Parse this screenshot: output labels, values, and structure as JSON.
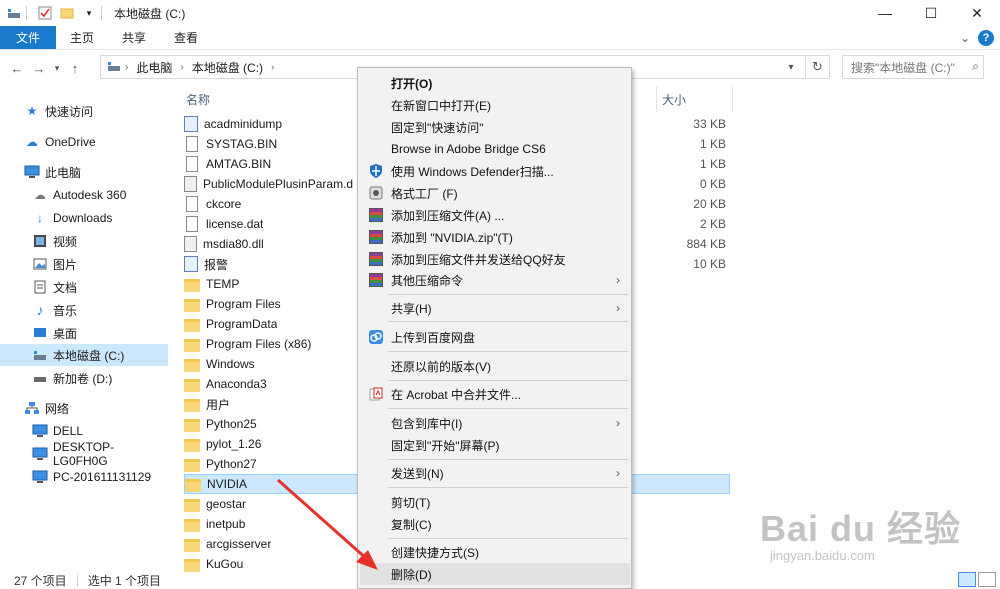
{
  "window": {
    "title": "本地磁盘 (C:)",
    "controls": {
      "minimize": "—",
      "maximize": "☐",
      "close": "✕"
    }
  },
  "ribbon": {
    "tabs": [
      "文件",
      "主页",
      "共享",
      "查看"
    ],
    "expand": "⌄",
    "help": "?"
  },
  "address": {
    "crumbs": [
      "此电脑",
      "本地磁盘 (C:)"
    ],
    "search_placeholder": "搜索\"本地磁盘 (C:)\""
  },
  "nav": {
    "items": [
      {
        "label": "快速访问",
        "icon": "star-icon"
      },
      {
        "label": "OneDrive",
        "icon": "cloud-icon"
      },
      {
        "label": "此电脑",
        "icon": "computer-icon"
      },
      {
        "label": "Autodesk 360",
        "icon": "cloud-drive-icon"
      },
      {
        "label": "Downloads",
        "icon": "download-icon"
      },
      {
        "label": "视频",
        "icon": "video-icon"
      },
      {
        "label": "图片",
        "icon": "picture-icon"
      },
      {
        "label": "文档",
        "icon": "document-icon"
      },
      {
        "label": "音乐",
        "icon": "music-icon"
      },
      {
        "label": "桌面",
        "icon": "desktop-icon"
      },
      {
        "label": "本地磁盘 (C:)",
        "icon": "drive-icon"
      },
      {
        "label": "新加卷 (D:)",
        "icon": "drive-icon"
      },
      {
        "label": "网络",
        "icon": "network-icon"
      },
      {
        "label": "DELL",
        "icon": "monitor-icon"
      },
      {
        "label": "DESKTOP-LG0FH0G",
        "icon": "monitor-icon"
      },
      {
        "label": "PC-201611131129",
        "icon": "monitor-icon"
      }
    ]
  },
  "files": {
    "header_name": "名称",
    "header_size": "大小",
    "rows": [
      {
        "name": "acadminidump",
        "size": "33 KB",
        "type": "exe"
      },
      {
        "name": "SYSTAG.BIN",
        "size": "1 KB",
        "type": "file"
      },
      {
        "name": "AMTAG.BIN",
        "size": "1 KB",
        "type": "file"
      },
      {
        "name": "PublicModulePlusinParam.d",
        "size": "0 KB",
        "type": "dll"
      },
      {
        "name": "ckcore",
        "size": "20 KB",
        "type": "file"
      },
      {
        "name": "license.dat",
        "size": "2 KB",
        "type": "file"
      },
      {
        "name": "msdia80.dll",
        "size": "884 KB",
        "type": "dll"
      },
      {
        "name": "报警",
        "size": "10 KB",
        "type": "exe"
      },
      {
        "name": "TEMP",
        "size": "",
        "type": "folder"
      },
      {
        "name": "Program Files",
        "size": "",
        "type": "folder"
      },
      {
        "name": "ProgramData",
        "size": "",
        "type": "folder"
      },
      {
        "name": "Program Files (x86)",
        "size": "",
        "type": "folder"
      },
      {
        "name": "Windows",
        "size": "",
        "type": "folder"
      },
      {
        "name": "Anaconda3",
        "size": "",
        "type": "folder"
      },
      {
        "name": "用户",
        "size": "",
        "type": "folder"
      },
      {
        "name": "Python25",
        "size": "",
        "type": "folder"
      },
      {
        "name": "pylot_1.26",
        "size": "",
        "type": "folder"
      },
      {
        "name": "Python27",
        "size": "",
        "type": "folder"
      },
      {
        "name": "NVIDIA",
        "size": "",
        "type": "folder"
      },
      {
        "name": "geostar",
        "size": "",
        "type": "folder"
      },
      {
        "name": "inetpub",
        "size": "",
        "type": "folder"
      },
      {
        "name": "arcgisserver",
        "size": "",
        "type": "folder"
      },
      {
        "name": "KuGou",
        "size": "",
        "type": "folder"
      }
    ]
  },
  "context_menu": {
    "open": "打开(O)",
    "open_new_window": "在新窗口中打开(E)",
    "pin_quick_access": "固定到\"快速访问\"",
    "adobe_bridge": "Browse in Adobe Bridge CS6",
    "defender": "使用 Windows Defender扫描...",
    "format_factory": "格式工厂 (F)",
    "add_archive": "添加到压缩文件(A) ...",
    "add_zip": "添加到 \"NVIDIA.zip\"(T)",
    "add_send_qq": "添加到压缩文件并发送给QQ好友",
    "other_compress": "其他压缩命令",
    "share": "共享(H)",
    "upload_baidu": "上传到百度网盘",
    "restore_prev": "还原以前的版本(V)",
    "acrobat_merge": "在 Acrobat 中合并文件...",
    "include_library": "包含到库中(I)",
    "pin_start": "固定到\"开始\"屏幕(P)",
    "send_to": "发送到(N)",
    "cut": "剪切(T)",
    "copy": "复制(C)",
    "create_shortcut": "创建快捷方式(S)",
    "delete": "删除(D)"
  },
  "status": {
    "item_count": "27 个项目",
    "selected": "选中 1 个项目"
  },
  "watermark": {
    "brand": "Bai du 经验",
    "url": "jingyan.baidu.com"
  },
  "colors": {
    "accent": "#1979ca",
    "selection": "#cce8ff",
    "arrow": "#e8312a"
  }
}
